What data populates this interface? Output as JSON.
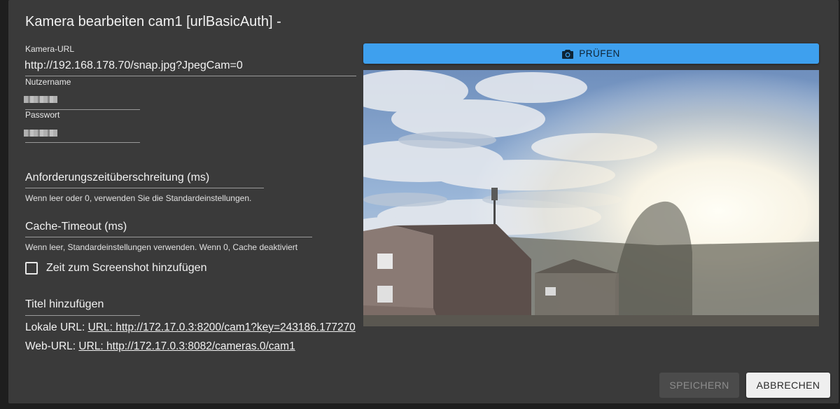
{
  "dialog": {
    "title": "Kamera bearbeiten cam1 [urlBasicAuth] -"
  },
  "form": {
    "camera_url": {
      "label": "Kamera-URL",
      "value": "http://192.168.178.70/snap.jpg?JpegCam=0"
    },
    "username": {
      "label": "Nutzername"
    },
    "password": {
      "label": "Passwort"
    },
    "timeout": {
      "placeholder": "Anforderungszeitüberschreitung (ms)",
      "helper": "Wenn leer oder 0, verwenden Sie die Standardeinstellungen."
    },
    "cache_timeout": {
      "placeholder": "Cache-Timeout (ms)",
      "helper": "Wenn leer, Standardeinstellungen verwenden. Wenn 0, Cache deaktiviert"
    },
    "add_time": {
      "label": "Zeit zum Screenshot hinzufügen",
      "checked": false
    },
    "add_title": {
      "placeholder": "Titel hinzufügen"
    },
    "local_url": {
      "label": "Lokale URL:",
      "link": "URL: http://172.17.0.3:8200/cam1?key=243186.177270"
    },
    "web_url": {
      "label": "Web-URL:",
      "link": "URL: http://172.17.0.3:8082/cameras.0/cam1"
    }
  },
  "preview": {
    "test_button_label": "PRÜFEN",
    "test_button_icon": "camera-icon"
  },
  "actions": {
    "save_label": "SPEICHERN",
    "save_disabled": true,
    "cancel_label": "ABBRECHEN"
  },
  "colors": {
    "dialog_bg": "#3a3a3a",
    "accent": "#3ea0ee"
  }
}
